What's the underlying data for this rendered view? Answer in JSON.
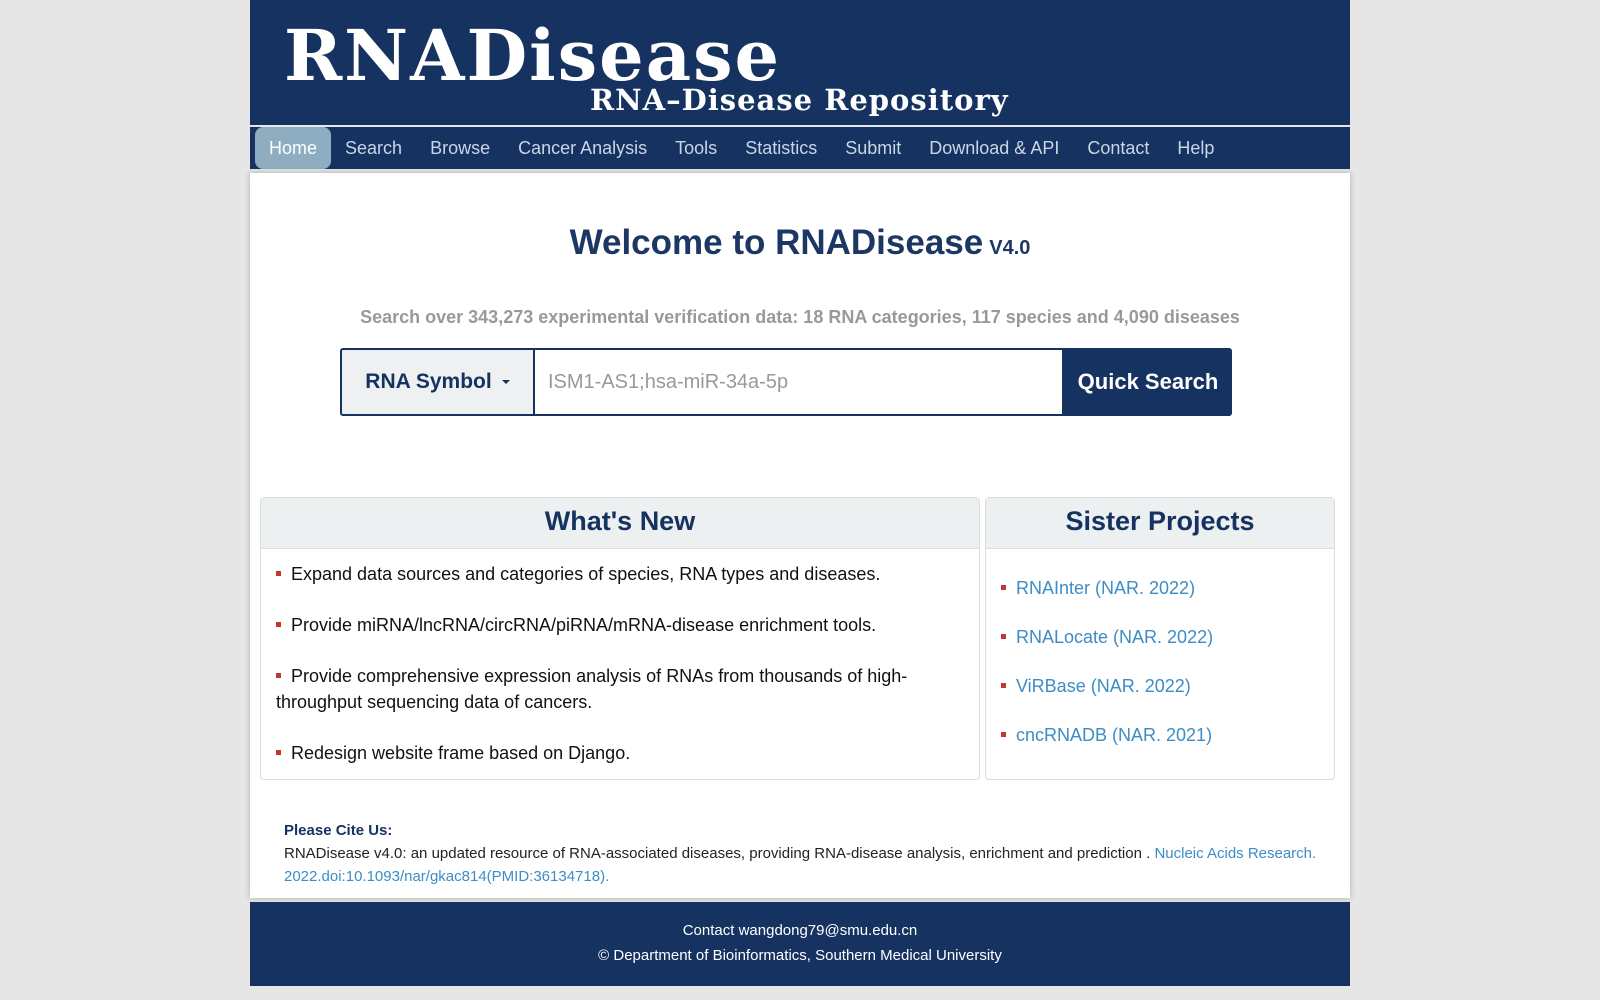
{
  "header": {
    "logo_title": "RNADisease",
    "logo_subtitle": "RNA–Disease Repository"
  },
  "nav": {
    "items": [
      {
        "label": "Home",
        "active": true
      },
      {
        "label": "Search"
      },
      {
        "label": "Browse"
      },
      {
        "label": "Cancer Analysis"
      },
      {
        "label": "Tools"
      },
      {
        "label": "Statistics"
      },
      {
        "label": "Submit"
      },
      {
        "label": "Download & API"
      },
      {
        "label": "Contact"
      },
      {
        "label": "Help"
      }
    ]
  },
  "welcome": {
    "title": "Welcome to RNADisease",
    "version": "V4.0"
  },
  "stats_text": "Search over 343,273 experimental verification data: 18 RNA categories, 117 species and 4,090 diseases",
  "search": {
    "select_label": "RNA Symbol",
    "placeholder": "ISM1-AS1;hsa-miR-34a-5p",
    "button_label": "Quick Search"
  },
  "whats_new": {
    "title": "What's New",
    "items": [
      "Expand data sources and categories of species, RNA types and diseases.",
      "Provide miRNA/lncRNA/circRNA/piRNA/mRNA-disease enrichment tools.",
      "Provide comprehensive expression analysis of RNAs from thousands of   high-throughput sequencing data of cancers.",
      "Redesign website frame based on Django."
    ]
  },
  "sister_projects": {
    "title": "Sister Projects",
    "items": [
      "RNAInter (NAR. 2022)",
      "RNALocate (NAR. 2022)",
      "ViRBase (NAR. 2022)",
      "cncRNADB (NAR. 2021)"
    ]
  },
  "cite": {
    "title": "Please Cite Us:",
    "text": "RNADisease v4.0: an updated resource of RNA-associated diseases, providing RNA-disease analysis, enrichment and prediction . ",
    "link": "Nucleic Acids Research. 2022.doi:10.1093/nar/gkac814(PMID:36134718)."
  },
  "footer": {
    "contact": "Contact wangdong79@smu.edu.cn",
    "copyright": "© Department of Bioinformatics, Southern Medical University"
  },
  "colors": {
    "brand_navy": "#163260",
    "nav_active": "#8eadc0",
    "link_blue": "#3c8dc5",
    "bullet_red": "#c0392b"
  }
}
